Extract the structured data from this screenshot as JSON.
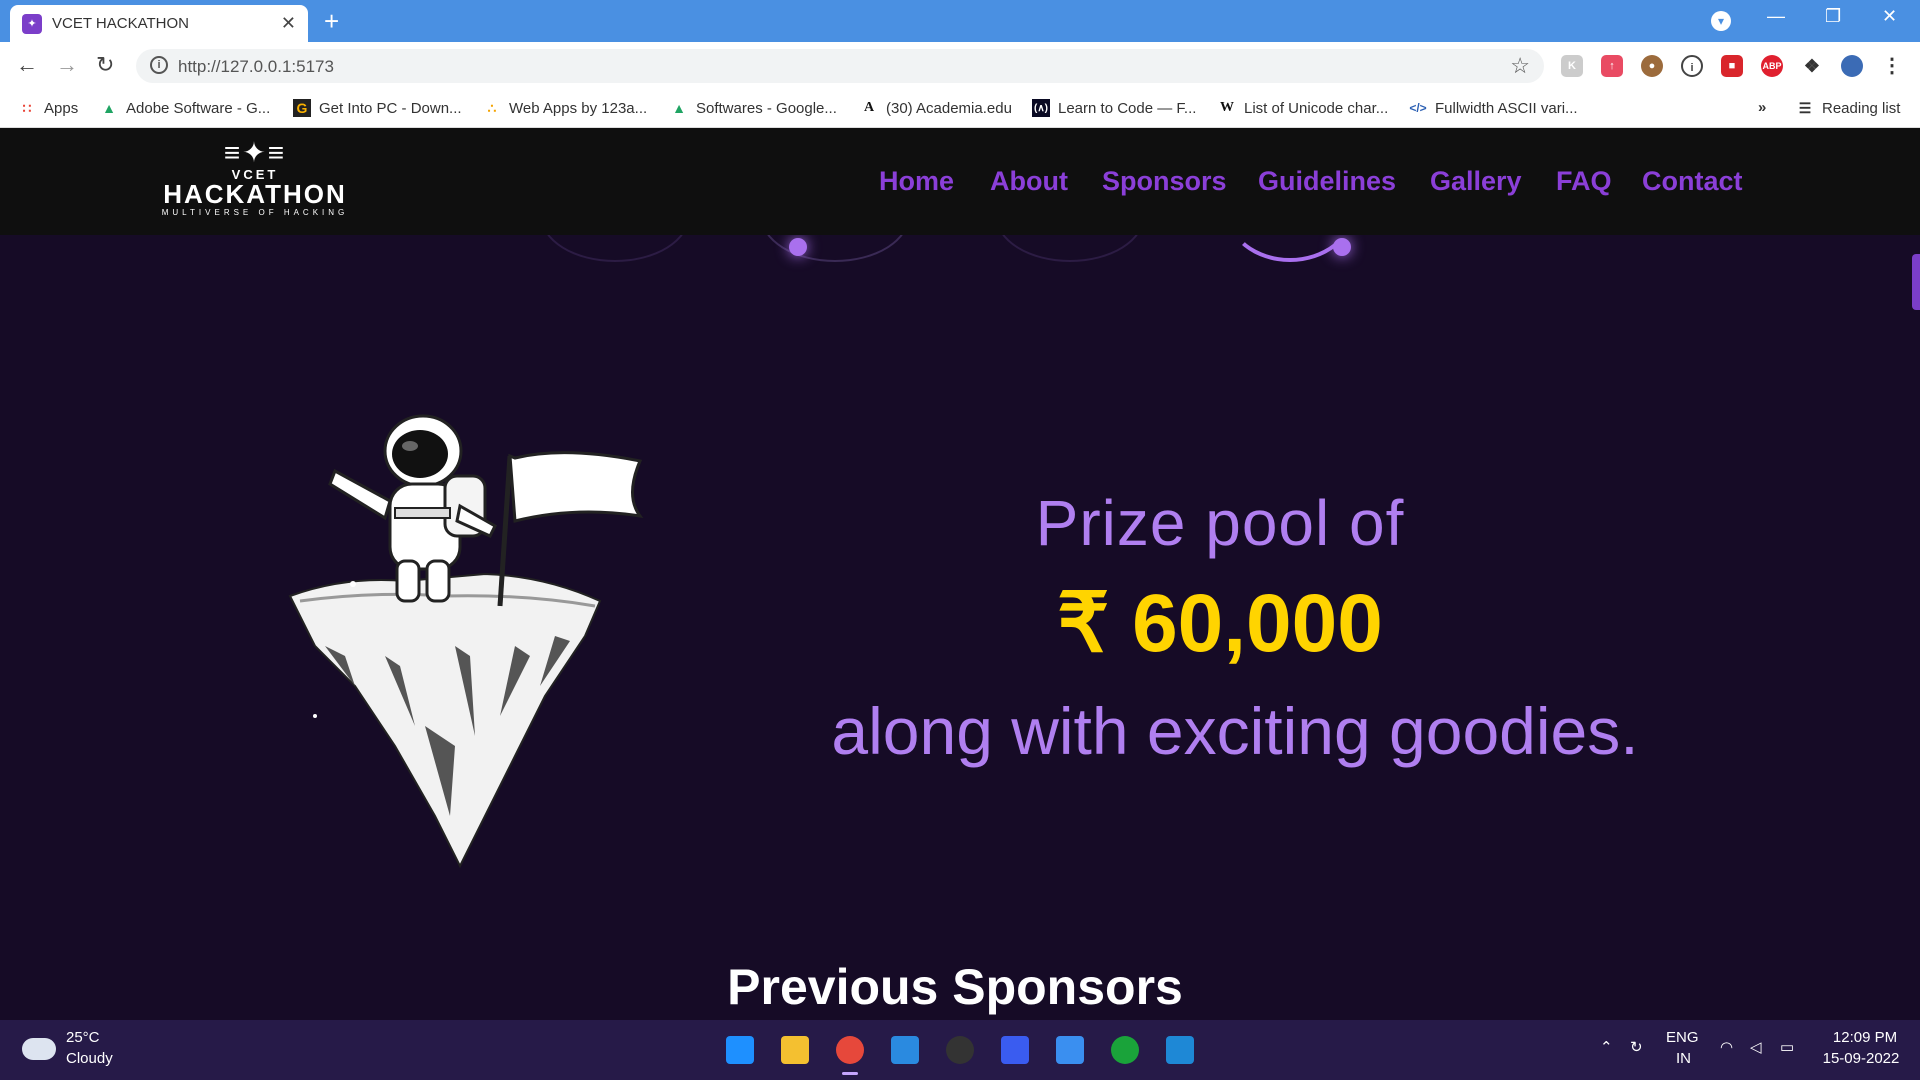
{
  "browser": {
    "tab_title": "VCET HACKATHON",
    "url": "http://127.0.0.1:5173",
    "bookmarks": [
      {
        "label": "Apps",
        "icon": "apps-grid-icon"
      },
      {
        "label": "Adobe Software - G...",
        "icon": "drive-icon"
      },
      {
        "label": "Get Into PC - Down...",
        "icon": "g-icon"
      },
      {
        "label": "Web Apps by 123a...",
        "icon": "dots-icon"
      },
      {
        "label": "Softwares - Google...",
        "icon": "drive-icon"
      },
      {
        "label": "(30) Academia.edu",
        "icon": "a-icon"
      },
      {
        "label": "Learn to Code — F...",
        "icon": "fcc-icon"
      },
      {
        "label": "List of Unicode char...",
        "icon": "wikipedia-icon"
      },
      {
        "label": "Fullwidth ASCII vari...",
        "icon": "code-icon"
      }
    ],
    "reading_list": "Reading list",
    "more": "»"
  },
  "site": {
    "logo": {
      "top": "VCET",
      "main": "HACKATHON",
      "tagline": "MULTIVERSE OF HACKING"
    },
    "nav": [
      "Home",
      "About",
      "Sponsors",
      "Guidelines",
      "Gallery",
      "FAQ",
      "Contact"
    ],
    "prize_line1": "Prize pool of",
    "prize_amount": "₹ 60,000",
    "prize_line3": "along with exciting goodies.",
    "section_heading": "Previous Sponsors"
  },
  "taskbar": {
    "weather_temp": "25°C",
    "weather_desc": "Cloudy",
    "lang": "ENG",
    "region": "IN",
    "time": "12:09 PM",
    "date": "15-09-2022"
  },
  "colors": {
    "accent": "#8b3fd8",
    "gold": "#ffd400",
    "background": "#160b26",
    "lavender": "#b07ff0"
  }
}
